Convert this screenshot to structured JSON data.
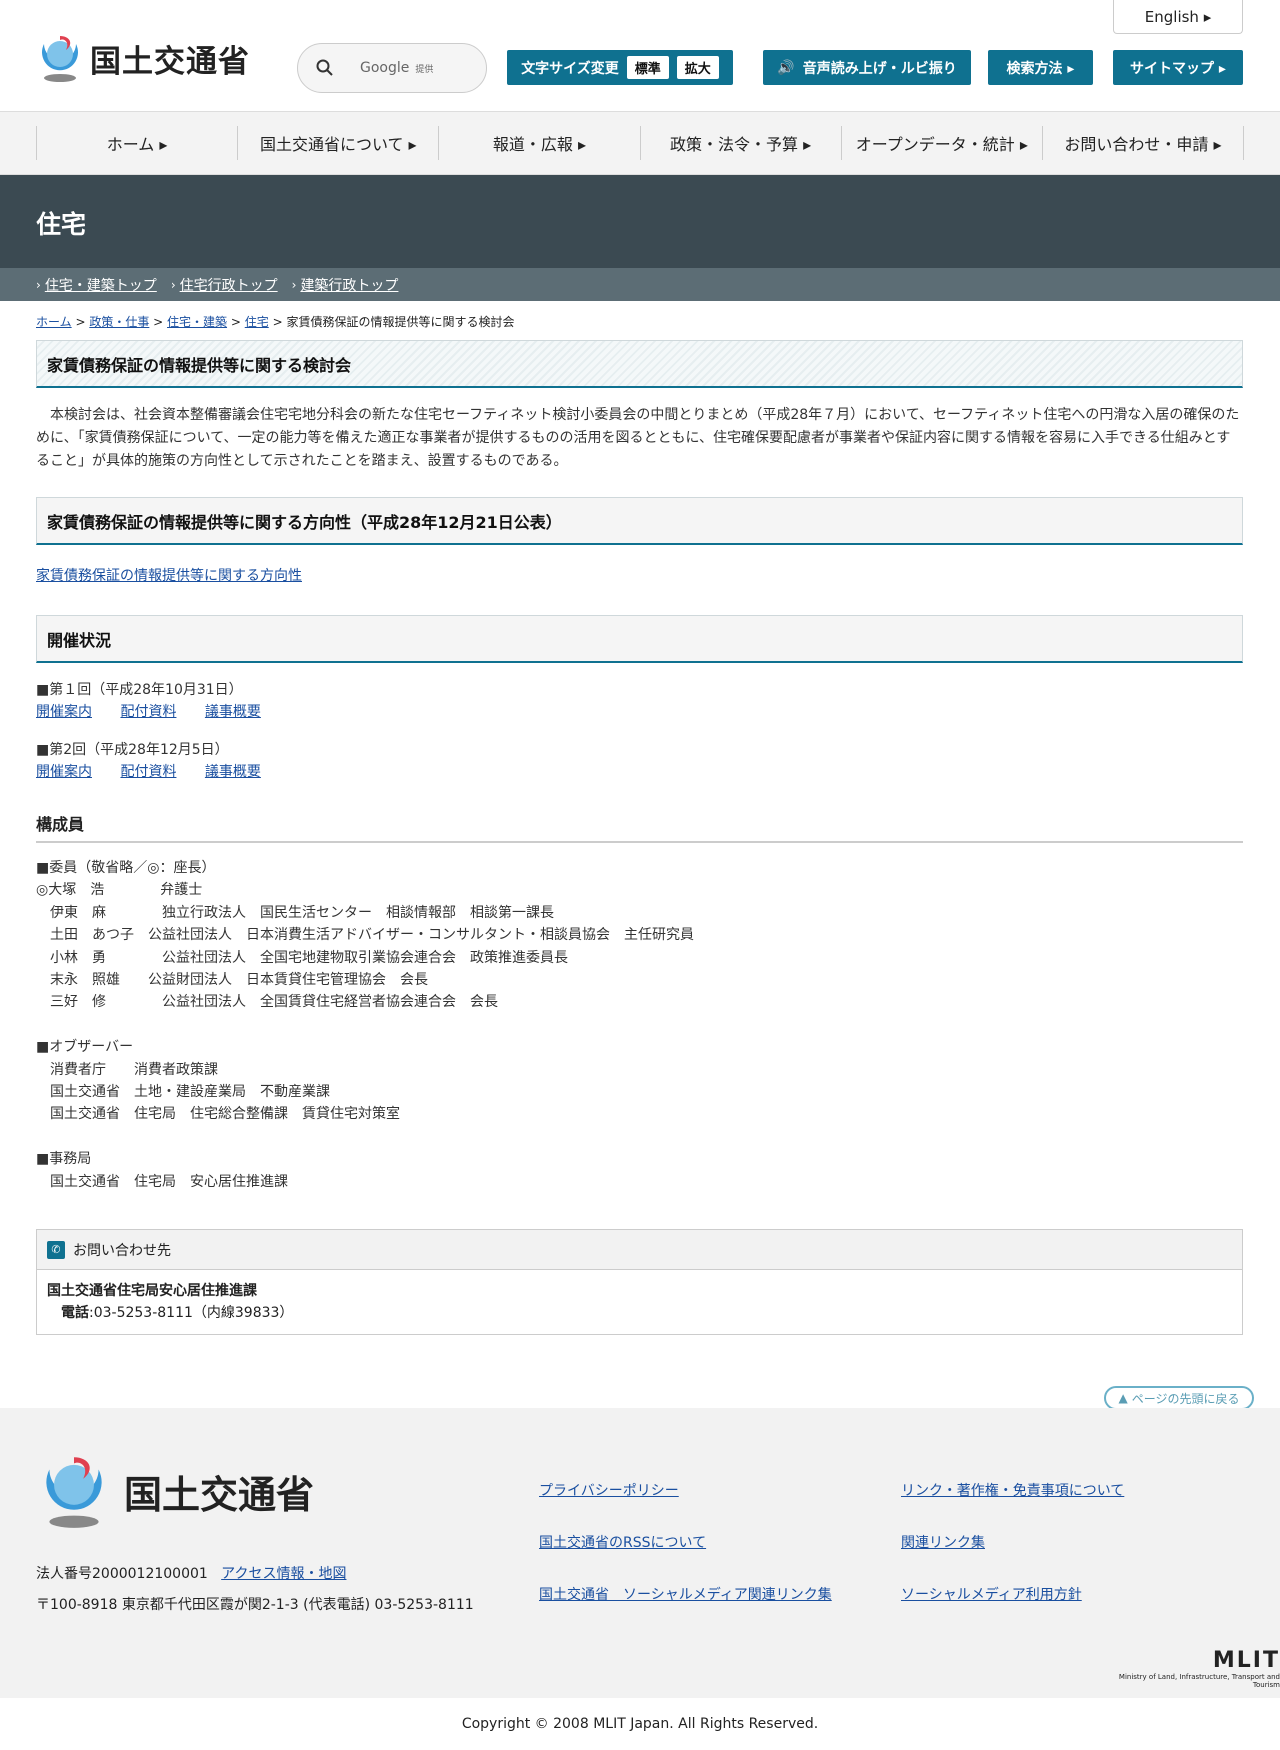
{
  "header": {
    "logo_text": "国土交通省",
    "english_label": "English ▸",
    "search_placeholder": "Google",
    "search_sub": "提供",
    "font_size_label": "文字サイズ変更",
    "font_standard": "標準",
    "font_large": "拡大",
    "speech_label": "音声読み上げ・ルビ振り",
    "search_method_label": "検索方法 ▸",
    "sitemap_label": "サイトマップ ▸"
  },
  "nav": [
    {
      "label": "ホーム ▸"
    },
    {
      "label": "国土交通省について ▸"
    },
    {
      "label": "報道・広報 ▸"
    },
    {
      "label": "政策・法令・予算 ▸"
    },
    {
      "label": "オープンデータ・統計 ▸"
    },
    {
      "label": "お問い合わせ・申請 ▸"
    }
  ],
  "title": "住宅",
  "sub_links": [
    "住宅・建築トップ",
    "住宅行政トップ",
    "建築行政トップ"
  ],
  "breadcrumb": {
    "items": [
      "ホーム",
      "政策・仕事",
      "住宅・建築",
      "住宅"
    ],
    "current": "家賃債務保証の情報提供等に関する検討会"
  },
  "main": {
    "heading": "家賃債務保証の情報提供等に関する検討会",
    "intro": "本検討会は、社会資本整備審議会住宅宅地分科会の新たな住宅セーフティネット検討小委員会の中間とりまとめ（平成28年７月）において、セーフティネット住宅への円滑な入居の確保のために、「家賃債務保証について、一定の能力等を備えた適正な事業者が提供するものの活用を図るとともに、住宅確保要配慮者が事業者や保証内容に関する情報を容易に入手できる仕組みとすること」が具体的施策の方向性として示されたことを踏まえ、設置するものである。",
    "direction_heading": "家賃債務保証の情報提供等に関する方向性（平成28年12月21日公表）",
    "direction_link": "家賃債務保証の情報提供等に関する方向性",
    "status_heading": "開催状況",
    "meetings": [
      {
        "title": "■第１回（平成28年10月31日）",
        "links": [
          "開催案内",
          "配付資料",
          "議事概要"
        ]
      },
      {
        "title": "■第2回（平成28年12月5日）",
        "links": [
          "開催案内",
          "配付資料",
          "議事概要"
        ]
      }
    ],
    "members_heading": "構成員",
    "members_text": "■委員（敬省略／◎：座長）\n◎大塚　浩　　　　弁護士\n　伊東　麻　　　　独立行政法人　国民生活センター　相談情報部　相談第一課長\n　土田　あつ子　公益社団法人　日本消費生活アドバイザー・コンサルタント・相談員協会　主任研究員\n　小林　勇　　　　公益社団法人　全国宅地建物取引業協会連合会　政策推進委員長\n　末永　照雄　　公益財団法人　日本賃貸住宅管理協会　会長\n　三好　修　　　　公益社団法人　全国賃貸住宅経営者協会連合会　会長\n\n■オブザーバー\n　消費者庁　　消費者政策課\n　国土交通省　土地・建設産業局　不動産業課\n　国土交通省　住宅局　住宅総合整備課　賃貸住宅対策室\n\n■事務局\n　国土交通省　住宅局　安心居住推進課",
    "contact_heading": "お問い合わせ先",
    "contact_org": "国土交通省住宅局安心居住推進課",
    "contact_phone_label": "電話",
    "contact_phone": ":03-5253-8111（内線39833）"
  },
  "pagetop": "ページの先頭に戻る",
  "footer": {
    "logo_text": "国土交通省",
    "corp_number": "法人番号2000012100001",
    "access_link": "アクセス情報・地図",
    "address": "〒100-8918 東京都千代田区霞が関2-1-3 (代表電話) 03-5253-8111",
    "links": [
      "プライバシーポリシー",
      "リンク・著作権・免責事項について",
      "国土交通省のRSSについて",
      "関連リンク集",
      "国土交通省　ソーシャルメディア関連リンク集",
      "ソーシャルメディア利用方針"
    ],
    "mlit": "MLIT",
    "mlit_sub": "Ministry of Land, Infrastructure, Transport and Tourism",
    "copyright": "Copyright © 2008 MLIT Japan. All Rights Reserved."
  }
}
